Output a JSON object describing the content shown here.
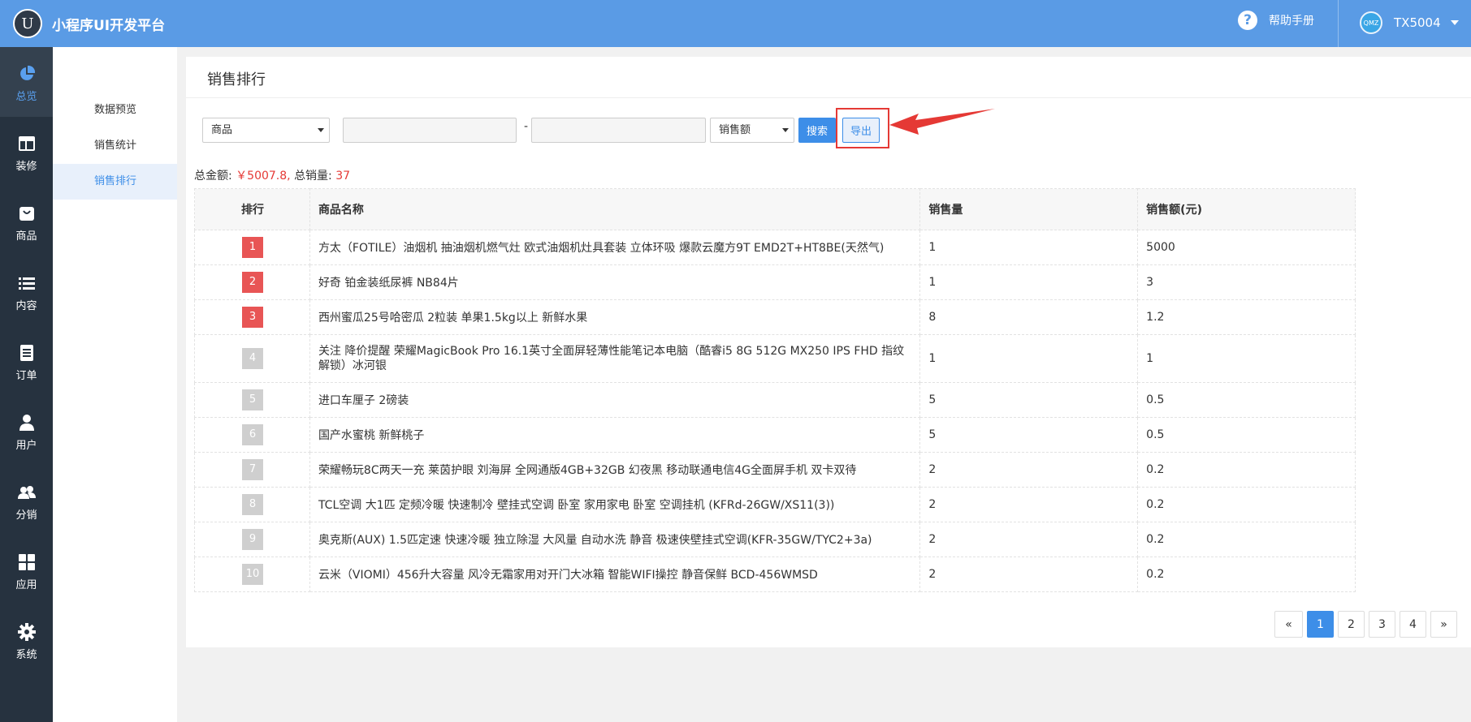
{
  "app": {
    "title": "小程序UI开发平台",
    "logo_glyph": "U"
  },
  "header": {
    "help_label": "帮助手册",
    "help_icon": "question-circle-icon",
    "user_name": "TX5004",
    "avatar_text": "QMZ"
  },
  "sidebar": {
    "items": [
      {
        "label": "总览",
        "icon": "pie-chart-icon",
        "active": true
      },
      {
        "label": "装修",
        "icon": "layout-icon",
        "active": false
      },
      {
        "label": "商品",
        "icon": "bag-icon",
        "active": false
      },
      {
        "label": "内容",
        "icon": "list-icon",
        "active": false
      },
      {
        "label": "订单",
        "icon": "document-icon",
        "active": false
      },
      {
        "label": "用户",
        "icon": "user-icon",
        "active": false
      },
      {
        "label": "分销",
        "icon": "users-icon",
        "active": false
      },
      {
        "label": "应用",
        "icon": "grid-icon",
        "active": false
      },
      {
        "label": "系统",
        "icon": "gear-icon",
        "active": false
      }
    ]
  },
  "subnav": {
    "items": [
      {
        "label": "数据预览",
        "active": false
      },
      {
        "label": "销售统计",
        "active": false
      },
      {
        "label": "销售排行",
        "active": true
      }
    ]
  },
  "page": {
    "title": "销售排行"
  },
  "filters": {
    "category_select": "商品",
    "start_value": "",
    "end_value": "",
    "separator": "-",
    "metric_select": "销售额",
    "search_label": "搜索",
    "export_label": "导出"
  },
  "summary": {
    "amount_label": "总金额:",
    "amount_value": "￥5007.8,",
    "qty_label": "总销量:",
    "qty_value": "37"
  },
  "table": {
    "headers": [
      "排行",
      "商品名称",
      "销售量",
      "销售额(元)"
    ],
    "rows": [
      {
        "rank": "1",
        "name": "方太（FOTILE）油烟机 抽油烟机燃气灶 欧式油烟机灶具套装 立体环吸 爆款云魔方9T EMD2T+HT8BE(天然气)",
        "qty": "1",
        "amount": "5000"
      },
      {
        "rank": "2",
        "name": "好奇 铂金装纸尿裤 NB84片",
        "qty": "1",
        "amount": "3"
      },
      {
        "rank": "3",
        "name": "西州蜜瓜25号哈密瓜 2粒装 单果1.5kg以上 新鲜水果",
        "qty": "8",
        "amount": "1.2"
      },
      {
        "rank": "4",
        "name": "关注 降价提醒 荣耀MagicBook Pro 16.1英寸全面屏轻薄性能笔记本电脑（酷睿i5 8G 512G MX250 IPS FHD 指纹解锁）冰河银",
        "qty": "1",
        "amount": "1"
      },
      {
        "rank": "5",
        "name": "进口车厘子 2磅装",
        "qty": "5",
        "amount": "0.5"
      },
      {
        "rank": "6",
        "name": "国产水蜜桃 新鲜桃子",
        "qty": "5",
        "amount": "0.5"
      },
      {
        "rank": "7",
        "name": "荣耀畅玩8C两天一充 莱茵护眼 刘海屏 全网通版4GB+32GB 幻夜黑 移动联通电信4G全面屏手机 双卡双待",
        "qty": "2",
        "amount": "0.2"
      },
      {
        "rank": "8",
        "name": "TCL空调 大1匹 定频冷暖 快速制冷 壁挂式空调 卧室 家用家电 卧室 空调挂机 (KFRd-26GW/XS11(3))",
        "qty": "2",
        "amount": "0.2"
      },
      {
        "rank": "9",
        "name": "奥克斯(AUX) 1.5匹定速 快速冷暖 独立除湿 大风量 自动水洗 静音 极速侠壁挂式空调(KFR-35GW/TYC2+3a)",
        "qty": "2",
        "amount": "0.2"
      },
      {
        "rank": "10",
        "name": "云米（VIOMI）456升大容量 风冷无霜家用对开门大冰箱 智能WIFI操控 静音保鲜 BCD-456WMSD",
        "qty": "2",
        "amount": "0.2"
      }
    ]
  },
  "pagination": {
    "prev": "«",
    "pages": [
      "1",
      "2",
      "3",
      "4"
    ],
    "current": "1",
    "next": "»"
  },
  "colors": {
    "header": "#5a9be5",
    "sidebar": "#26323f",
    "accent": "#3d8ee8",
    "rank_top": "#e85555",
    "rank_other": "#cfcfcf",
    "highlight": "#e53935"
  }
}
